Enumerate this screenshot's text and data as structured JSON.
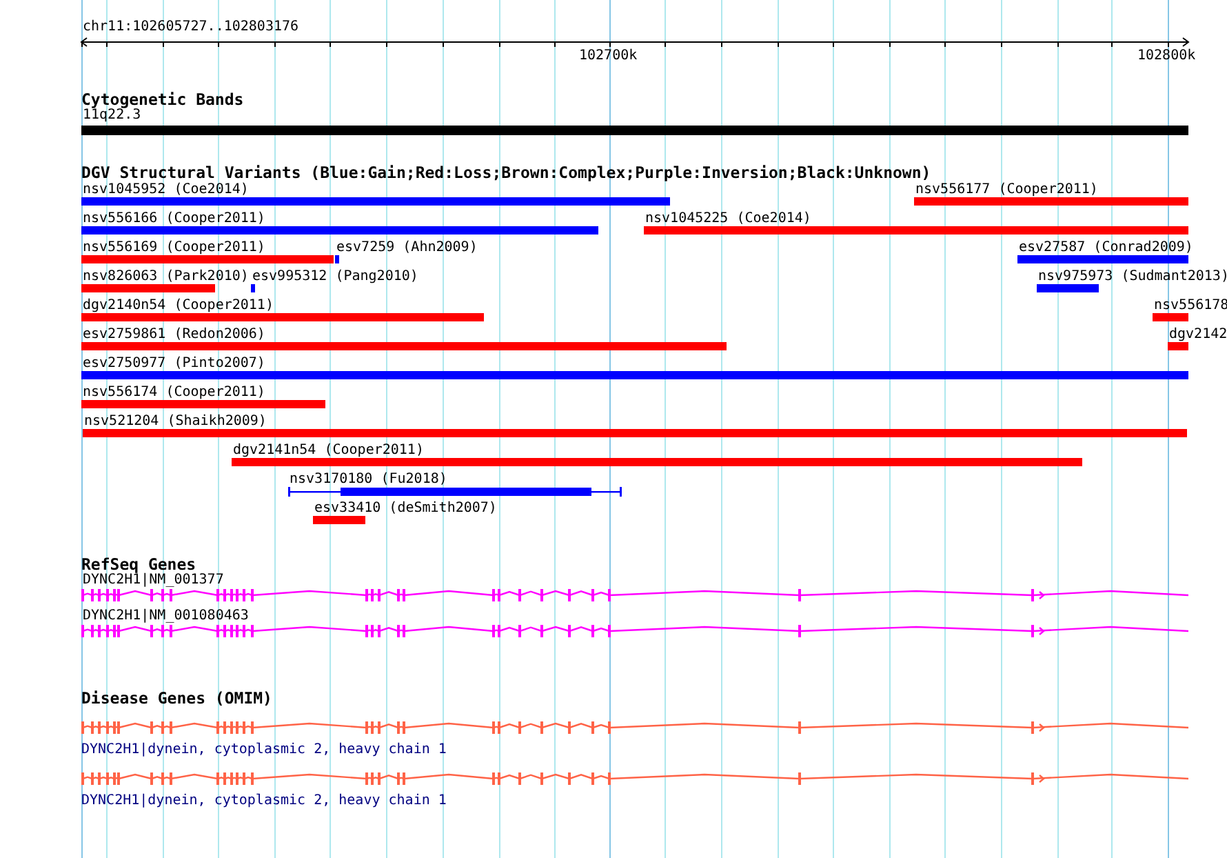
{
  "ruler": {
    "region": "chr11:102605727..102803176",
    "ticks": [
      "102700k",
      "102800k"
    ]
  },
  "tracks": [
    {
      "kind": "bands",
      "title": "Cytogenetic Bands",
      "features": [
        {
          "label": "11q22.3"
        }
      ]
    },
    {
      "kind": "variants",
      "title": "DGV Structural Variants (Blue:Gain;Red:Loss;Brown:Complex;Purple:Inversion;Black:Unknown)",
      "rows": [
        {
          "features": [
            {
              "label": "nsv1045952 (Coe2014)",
              "color": "#0000ff",
              "kind": "bar"
            },
            {
              "label": "nsv556177 (Cooper2011)",
              "color": "#ff0000",
              "kind": "bar"
            }
          ]
        },
        {
          "features": [
            {
              "label": "nsv556166 (Cooper2011)",
              "color": "#0000ff",
              "kind": "bar"
            },
            {
              "label": "nsv1045225 (Coe2014)",
              "color": "#ff0000",
              "kind": "bar"
            }
          ]
        },
        {
          "features": [
            {
              "label": "nsv556169 (Cooper2011)",
              "color": "#ff0000",
              "kind": "bar"
            },
            {
              "label": "esv7259 (Ahn2009)",
              "color": "#0000ff",
              "kind": "bar"
            },
            {
              "label": "esv27587 (Conrad2009)",
              "color": "#0000ff",
              "kind": "bar"
            }
          ]
        },
        {
          "features": [
            {
              "label": "nsv826063 (Park2010)",
              "color": "#ff0000",
              "kind": "bar"
            },
            {
              "label": "esv995312 (Pang2010)",
              "color": "#0000ff",
              "kind": "bar"
            },
            {
              "label": "nsv975973 (Sudmant2013)",
              "color": "#0000ff",
              "kind": "bar"
            }
          ]
        },
        {
          "features": [
            {
              "label": "dgv2140n54 (Cooper2011)",
              "color": "#ff0000",
              "kind": "bar"
            },
            {
              "label": "nsv556178",
              "color": "#ff0000",
              "kind": "bar"
            }
          ]
        },
        {
          "features": [
            {
              "label": "esv2759861 (Redon2006)",
              "color": "#ff0000",
              "kind": "bar"
            },
            {
              "label": "dgv2142",
              "color": "#ff0000",
              "kind": "bar"
            }
          ]
        },
        {
          "features": [
            {
              "label": "esv2750977 (Pinto2007)",
              "color": "#0000ff",
              "kind": "bar"
            }
          ]
        },
        {
          "features": [
            {
              "label": "nsv556174 (Cooper2011)",
              "color": "#ff0000",
              "kind": "bar"
            }
          ]
        },
        {
          "features": [
            {
              "label": "nsv521204 (Shaikh2009)",
              "color": "#ff0000",
              "kind": "bar"
            }
          ]
        },
        {
          "features": [
            {
              "label": "dgv2141n54 (Cooper2011)",
              "color": "#ff0000",
              "kind": "bar"
            }
          ]
        },
        {
          "features": [
            {
              "label": "nsv3170180 (Fu2018)",
              "color": "#0000ff",
              "kind": "split"
            }
          ]
        },
        {
          "features": [
            {
              "label": "esv33410 (deSmith2007)",
              "color": "#ff0000",
              "kind": "bar"
            }
          ]
        }
      ]
    },
    {
      "kind": "genes",
      "title": "RefSeq Genes",
      "features": [
        {
          "label": "DYNC2H1|NM_001377"
        },
        {
          "label": "DYNC2H1|NM_001080463"
        }
      ]
    },
    {
      "kind": "disease",
      "title": "Disease Genes (OMIM)",
      "features": [
        {
          "label": "DYNC2H1|dynein, cytoplasmic 2, heavy chain 1"
        },
        {
          "label": "DYNC2H1|dynein, cytoplasmic 2, heavy chain 1"
        }
      ]
    }
  ]
}
